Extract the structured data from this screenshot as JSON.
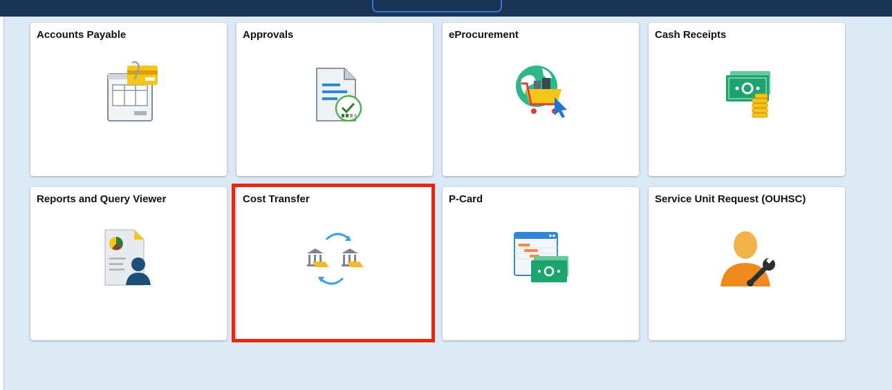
{
  "tiles": [
    {
      "title": "Accounts Payable",
      "icon": "accounts-payable-icon"
    },
    {
      "title": "Approvals",
      "icon": "approvals-icon"
    },
    {
      "title": "eProcurement",
      "icon": "eprocurement-icon"
    },
    {
      "title": "Cash Receipts",
      "icon": "cash-receipts-icon"
    },
    {
      "title": "Reports and Query Viewer",
      "icon": "reports-query-viewer-icon"
    },
    {
      "title": "Cost Transfer",
      "icon": "cost-transfer-icon",
      "highlighted": true
    },
    {
      "title": "P-Card",
      "icon": "p-card-icon"
    },
    {
      "title": "Service Unit Request (OUHSC)",
      "icon": "service-unit-request-icon"
    }
  ],
  "colors": {
    "page_bg": "#dbe8f5",
    "topbar": "#1c3557",
    "highlight": "#f0230f",
    "tile_bg": "#ffffff"
  }
}
